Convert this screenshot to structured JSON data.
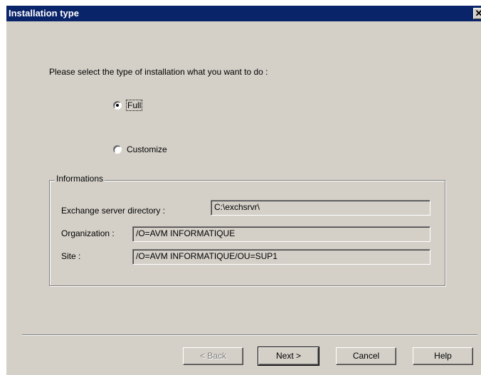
{
  "window": {
    "title": "Installation type",
    "close_symbol": "✕"
  },
  "prompt": "Please select the type of installation what you want to do :",
  "options": [
    {
      "label": "Full",
      "selected": true
    },
    {
      "label": "Customize",
      "selected": false
    }
  ],
  "informations": {
    "legend": "Informations",
    "exchange_dir_label": "Exchange server directory :",
    "exchange_dir_value": "C:\\exchsrvr\\",
    "organization_label": "Organization :",
    "organization_value": "/O=AVM INFORMATIQUE",
    "site_label": "Site :",
    "site_value": "/O=AVM INFORMATIQUE/OU=SUP1"
  },
  "buttons": {
    "back": "< Back",
    "next": "Next >",
    "cancel": "Cancel",
    "help": "Help"
  },
  "colors": {
    "titlebar": "#0a246a",
    "face": "#d4d0c8"
  }
}
